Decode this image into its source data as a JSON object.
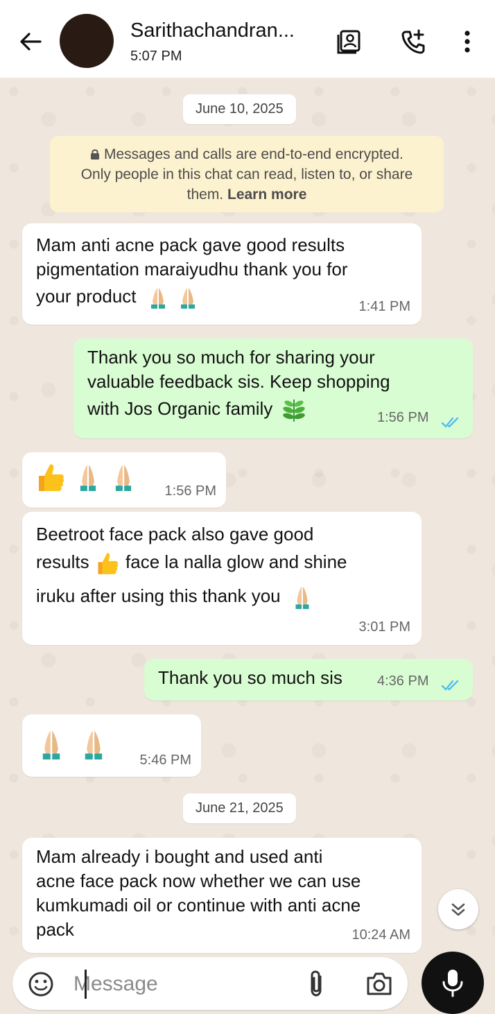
{
  "header": {
    "contact_name": "Sarithachandran...",
    "last_seen": "5:07 PM"
  },
  "chat": {
    "dates": [
      "June 10, 2025",
      "June 21, 2025"
    ],
    "encryption_notice": {
      "line1": "Messages and calls are end-to-end encrypted.",
      "line2": "Only people in this chat can read, listen to, or share",
      "line3_prefix": "them.",
      "learn_more": "Learn more"
    },
    "messages": [
      {
        "direction": "in",
        "lines": [
          "Mam anti acne pack gave good results",
          "pigmentation maraiyudhu thank you for",
          "your product"
        ],
        "emojis": [
          "folded-hands",
          "folded-hands"
        ],
        "time": "1:41 PM"
      },
      {
        "direction": "out",
        "lines": [
          "Thank you so much for sharing your",
          "valuable feedback sis. Keep shopping",
          "with Jos Organic family"
        ],
        "emojis": [
          "herb"
        ],
        "time": "1:56 PM",
        "status": "read"
      },
      {
        "direction": "in",
        "lines": [],
        "emojis": [
          "thumbs-up",
          "folded-hands",
          "folded-hands"
        ],
        "time": "1:56 PM"
      },
      {
        "direction": "in",
        "lines": [
          "Beetroot face pack also gave good",
          "results",
          "face la nalla glow and shine",
          "iruku after using this thank you"
        ],
        "emojis": [
          "thumbs-up",
          "folded-hands"
        ],
        "time": "3:01 PM"
      },
      {
        "direction": "out",
        "lines": [
          "Thank you so much sis"
        ],
        "emojis": [],
        "time": "4:36 PM",
        "status": "read"
      },
      {
        "direction": "in",
        "lines": [],
        "emojis": [
          "folded-hands",
          "folded-hands"
        ],
        "time": "5:46 PM"
      },
      {
        "direction": "in",
        "lines": [
          "Mam already i bought and used anti",
          "acne face pack now whether we can use",
          "kumkumadi oil or continue with anti acne",
          "pack"
        ],
        "emojis": [],
        "time": "10:24 AM"
      }
    ]
  },
  "composer": {
    "placeholder": "Message"
  },
  "colors": {
    "chat_background": "#efe7de",
    "incoming_bubble": "#ffffff",
    "outgoing_bubble": "#d9fdd3",
    "read_ticks": "#53bdeb",
    "mic_button": "#111111"
  },
  "icons": [
    "back-arrow-icon",
    "contact-card-icon",
    "add-call-icon",
    "more-vert-icon",
    "lock-icon",
    "double-check-icon",
    "scroll-down-icon",
    "sticker-icon",
    "attach-icon",
    "camera-icon",
    "mic-icon"
  ]
}
